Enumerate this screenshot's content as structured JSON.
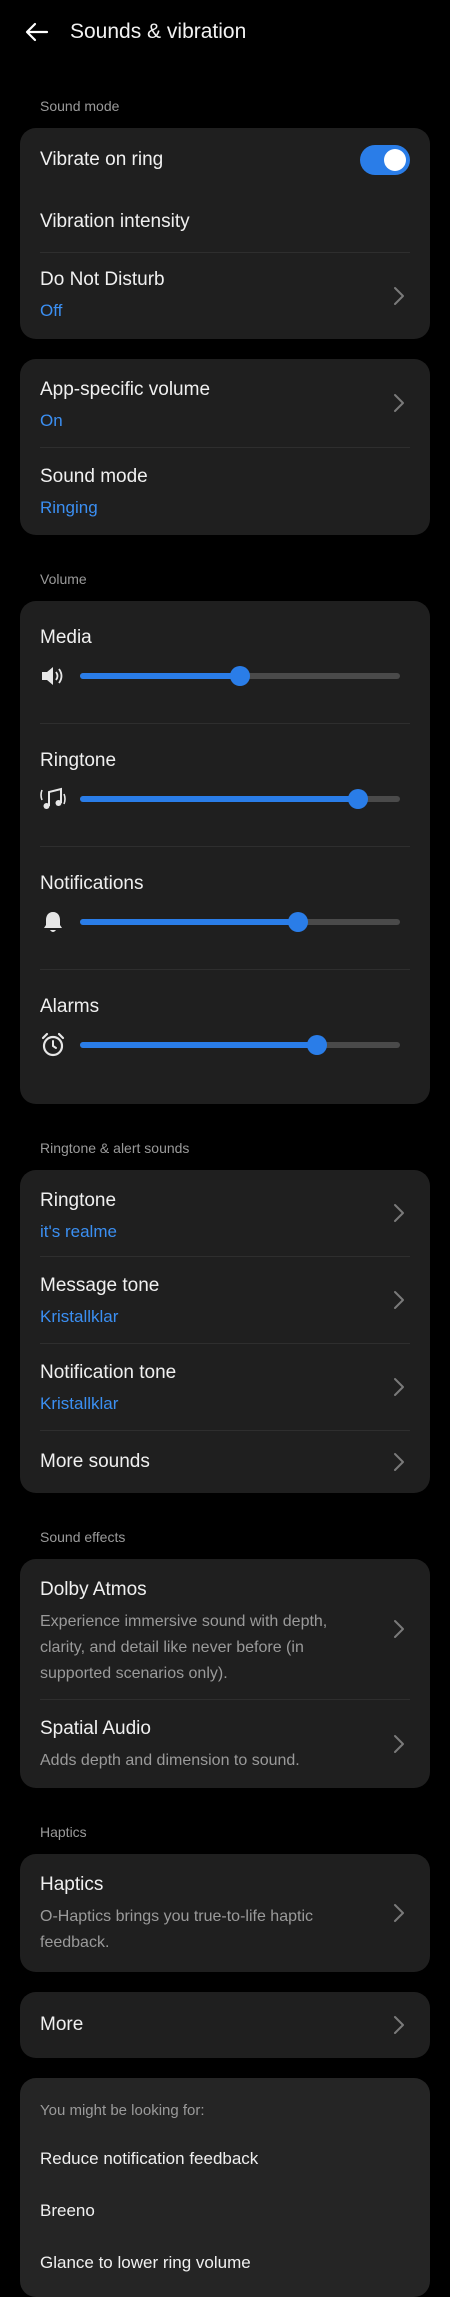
{
  "header": {
    "title": "Sounds & vibration"
  },
  "sound_mode_section": {
    "label": "Sound mode",
    "vibrate_on_ring": {
      "label": "Vibrate on ring",
      "enabled": true
    },
    "vibration_intensity": {
      "label": "Vibration intensity"
    },
    "do_not_disturb": {
      "label": "Do Not Disturb",
      "value": "Off"
    },
    "app_specific_volume": {
      "label": "App-specific volume",
      "value": "On"
    },
    "sound_mode": {
      "label": "Sound mode",
      "value": "Ringing"
    }
  },
  "volume_section": {
    "label": "Volume",
    "sliders": [
      {
        "label": "Media",
        "icon": "speaker-icon",
        "level_percent": 50
      },
      {
        "label": "Ringtone",
        "icon": "ringtone-icon",
        "level_percent": 87
      },
      {
        "label": "Notifications",
        "icon": "bell-icon",
        "level_percent": 68
      },
      {
        "label": "Alarms",
        "icon": "alarm-clock-icon",
        "level_percent": 74
      }
    ]
  },
  "ringtone_section": {
    "label": "Ringtone & alert sounds",
    "ringtone": {
      "label": "Ringtone",
      "value": "it's realme"
    },
    "message_tone": {
      "label": "Message tone",
      "value": "Kristallklar"
    },
    "notification_tone": {
      "label": "Notification tone",
      "value": "Kristallklar"
    },
    "more_sounds": {
      "label": "More sounds"
    }
  },
  "sound_effects_section": {
    "label": "Sound effects",
    "dolby_atmos": {
      "label": "Dolby Atmos",
      "description": "Experience immersive sound with depth, clarity, and detail like never before (in supported scenarios only)."
    },
    "spatial_audio": {
      "label": "Spatial Audio",
      "description": "Adds depth and dimension to sound."
    }
  },
  "haptics_section": {
    "label": "Haptics",
    "haptics": {
      "label": "Haptics",
      "description": "O-Haptics brings you true-to-life haptic feedback."
    }
  },
  "more": {
    "label": "More"
  },
  "suggestions": {
    "label": "You might be looking for:",
    "items": [
      "Reduce notification feedback",
      "Breeno",
      "Glance to lower ring volume"
    ]
  },
  "colors": {
    "accent": "#2a7de8",
    "value_text": "#3b8ff2",
    "card": "#1f1f1f",
    "background": "#000000"
  }
}
